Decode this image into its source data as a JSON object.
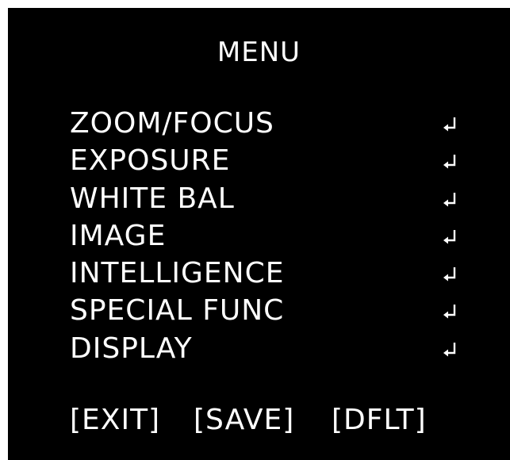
{
  "menu": {
    "title": "MENU",
    "items": [
      {
        "label": "ZOOM/FOCUS",
        "icon": "enter-icon"
      },
      {
        "label": "EXPOSURE",
        "icon": "enter-icon"
      },
      {
        "label": "WHITE BAL",
        "icon": "enter-icon"
      },
      {
        "label": "IMAGE",
        "icon": "enter-icon"
      },
      {
        "label": "INTELLIGENCE",
        "icon": "enter-icon"
      },
      {
        "label": "SPECIAL FUNC",
        "icon": "enter-icon"
      },
      {
        "label": "DISPLAY",
        "icon": "enter-icon"
      }
    ]
  },
  "footer": {
    "exit_label": "[EXIT]",
    "save_label": "[SAVE]",
    "dflt_label": "[DFLT]"
  },
  "colors": {
    "background": "#000000",
    "text": "#ffffff",
    "page": "#ffffff"
  }
}
